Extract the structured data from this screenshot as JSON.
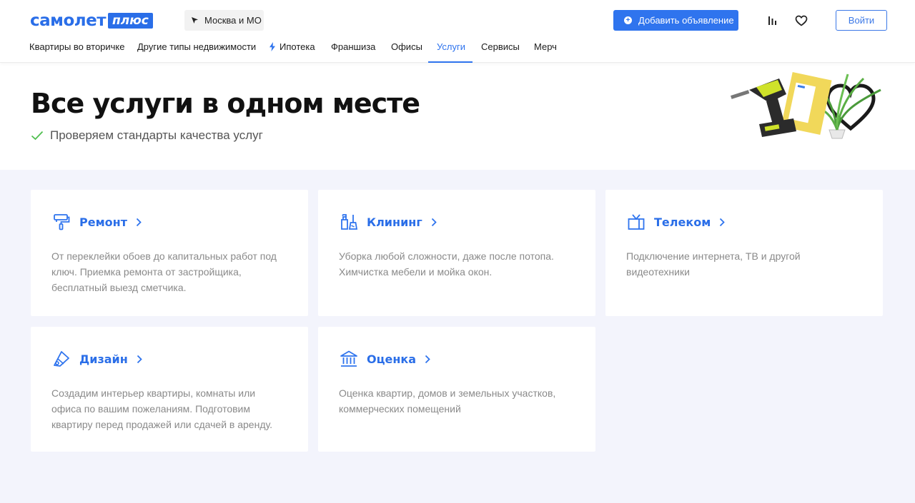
{
  "header": {
    "logo_main": "самолет",
    "logo_plus": "плюс",
    "city": "Москва и МО",
    "add_listing": "Добавить объявление",
    "login": "Войти"
  },
  "nav": {
    "items": [
      {
        "label": "Квартиры во вторичке"
      },
      {
        "label": "Другие типы недвижимости"
      },
      {
        "label": "Ипотека"
      },
      {
        "label": "Франшиза"
      },
      {
        "label": "Офисы"
      },
      {
        "label": "Услуги",
        "active": true
      },
      {
        "label": "Сервисы"
      },
      {
        "label": "Мерч"
      }
    ]
  },
  "hero": {
    "title": "Все услуги в одном месте",
    "subtitle": "Проверяем стандарты качества услуг"
  },
  "services": [
    {
      "title": "Ремонт",
      "icon": "paint-roller-icon",
      "description": "От переклейки обоев до капитальных работ под ключ. Приемка ремонта от застройщика, бесплатный выезд сметчика."
    },
    {
      "title": "Клининг",
      "icon": "cleaning-icon",
      "description": "Уборка любой сложности, даже после потопа. Химчистка мебели и мойка окон."
    },
    {
      "title": "Телеком",
      "icon": "tv-icon",
      "description": "Подключение интернета, ТВ и другой видеотехники"
    },
    {
      "title": "Дизайн",
      "icon": "design-icon",
      "description": "Создадим интерьер квартиры, комнаты или офиса по вашим пожеланиям. Подготовим квартиру перед продажей или сдачей в аренду."
    },
    {
      "title": "Оценка",
      "icon": "bank-icon",
      "description": "Оценка квартир, домов и земельных участков, коммерческих помещений"
    }
  ],
  "colors": {
    "accent": "#2f74ee",
    "services_background": "#f3f4fc",
    "check_green": "#4fbf4f"
  }
}
